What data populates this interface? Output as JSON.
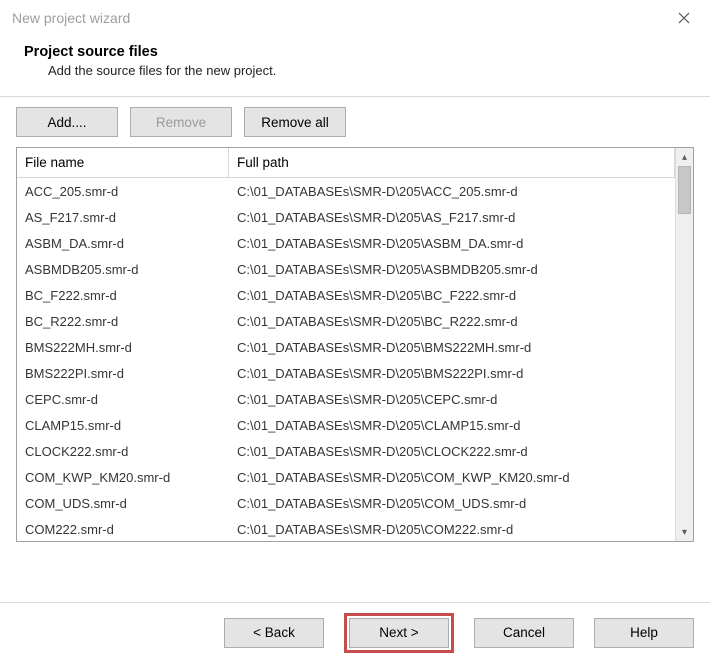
{
  "window": {
    "title": "New project wizard"
  },
  "header": {
    "title": "Project source files",
    "subtitle": "Add the source files for the new project."
  },
  "toolbar": {
    "add_label": "Add....",
    "remove_label": "Remove",
    "remove_all_label": "Remove all"
  },
  "list": {
    "columns": {
      "filename": "File name",
      "fullpath": "Full path"
    },
    "rows": [
      {
        "filename": "ACC_205.smr-d",
        "path": "C:\\01_DATABASEs\\SMR-D\\205\\ACC_205.smr-d"
      },
      {
        "filename": "AS_F217.smr-d",
        "path": "C:\\01_DATABASEs\\SMR-D\\205\\AS_F217.smr-d"
      },
      {
        "filename": "ASBM_DA.smr-d",
        "path": "C:\\01_DATABASEs\\SMR-D\\205\\ASBM_DA.smr-d"
      },
      {
        "filename": "ASBMDB205.smr-d",
        "path": "C:\\01_DATABASEs\\SMR-D\\205\\ASBMDB205.smr-d"
      },
      {
        "filename": "BC_F222.smr-d",
        "path": "C:\\01_DATABASEs\\SMR-D\\205\\BC_F222.smr-d"
      },
      {
        "filename": "BC_R222.smr-d",
        "path": "C:\\01_DATABASEs\\SMR-D\\205\\BC_R222.smr-d"
      },
      {
        "filename": "BMS222MH.smr-d",
        "path": "C:\\01_DATABASEs\\SMR-D\\205\\BMS222MH.smr-d"
      },
      {
        "filename": "BMS222PI.smr-d",
        "path": "C:\\01_DATABASEs\\SMR-D\\205\\BMS222PI.smr-d"
      },
      {
        "filename": "CEPC.smr-d",
        "path": "C:\\01_DATABASEs\\SMR-D\\205\\CEPC.smr-d"
      },
      {
        "filename": "CLAMP15.smr-d",
        "path": "C:\\01_DATABASEs\\SMR-D\\205\\CLAMP15.smr-d"
      },
      {
        "filename": "CLOCK222.smr-d",
        "path": "C:\\01_DATABASEs\\SMR-D\\205\\CLOCK222.smr-d"
      },
      {
        "filename": "COM_KWP_KM20.smr-d",
        "path": "C:\\01_DATABASEs\\SMR-D\\205\\COM_KWP_KM20.smr-d"
      },
      {
        "filename": "COM_UDS.smr-d",
        "path": "C:\\01_DATABASEs\\SMR-D\\205\\COM_UDS.smr-d"
      },
      {
        "filename": "COM222.smr-d",
        "path": "C:\\01_DATABASEs\\SMR-D\\205\\COM222.smr-d"
      }
    ]
  },
  "footer": {
    "back_label": "< Back",
    "next_label": "Next >",
    "cancel_label": "Cancel",
    "help_label": "Help"
  }
}
